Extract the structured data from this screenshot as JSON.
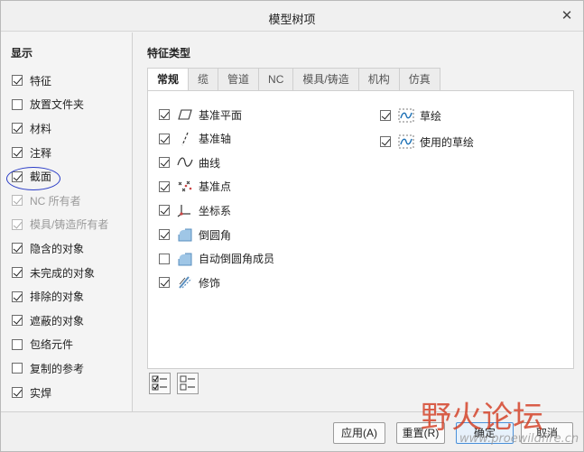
{
  "window": {
    "title": "模型树项"
  },
  "display": {
    "title": "显示",
    "items": [
      {
        "label": "特征",
        "checked": true,
        "enabled": true
      },
      {
        "label": "放置文件夹",
        "checked": false,
        "enabled": true
      },
      {
        "label": "材料",
        "checked": true,
        "enabled": true
      },
      {
        "label": "注释",
        "checked": true,
        "enabled": true
      },
      {
        "label": "截面",
        "checked": true,
        "enabled": true
      },
      {
        "label": "NC 所有者",
        "checked": true,
        "enabled": false
      },
      {
        "label": "模具/铸造所有者",
        "checked": true,
        "enabled": false
      },
      {
        "label": "隐含的对象",
        "checked": true,
        "enabled": true
      },
      {
        "label": "未完成的对象",
        "checked": true,
        "enabled": true
      },
      {
        "label": "排除的对象",
        "checked": true,
        "enabled": true
      },
      {
        "label": "遮蔽的对象",
        "checked": true,
        "enabled": true
      },
      {
        "label": "包络元件",
        "checked": false,
        "enabled": true
      },
      {
        "label": "复制的参考",
        "checked": false,
        "enabled": true
      },
      {
        "label": "实焊",
        "checked": true,
        "enabled": true
      }
    ]
  },
  "features": {
    "title": "特征类型",
    "tabs": [
      "常规",
      "缆",
      "管道",
      "NC",
      "模具/铸造",
      "机构",
      "仿真"
    ],
    "active_tab": 0,
    "left_column": [
      {
        "label": "基准平面",
        "checked": true,
        "icon": "datum-plane-icon"
      },
      {
        "label": "基准轴",
        "checked": true,
        "icon": "datum-axis-icon"
      },
      {
        "label": "曲线",
        "checked": true,
        "icon": "curve-icon"
      },
      {
        "label": "基准点",
        "checked": true,
        "icon": "datum-point-icon"
      },
      {
        "label": "坐标系",
        "checked": true,
        "icon": "coordinate-system-icon"
      },
      {
        "label": "倒圆角",
        "checked": true,
        "icon": "round-icon"
      },
      {
        "label": "自动倒圆角成员",
        "checked": false,
        "icon": "auto-round-member-icon"
      },
      {
        "label": "修饰",
        "checked": true,
        "icon": "cosmetic-icon"
      }
    ],
    "right_column": [
      {
        "label": "草绘",
        "checked": true,
        "icon": "sketch-icon"
      },
      {
        "label": "使用的草绘",
        "checked": true,
        "icon": "used-sketch-icon"
      }
    ]
  },
  "footer": {
    "apply": "应用(A)",
    "reset": "重置(R)",
    "ok": "确定",
    "cancel": "取消"
  },
  "watermark": {
    "text": "野火论坛",
    "url": "www.proewildfire.cn"
  }
}
